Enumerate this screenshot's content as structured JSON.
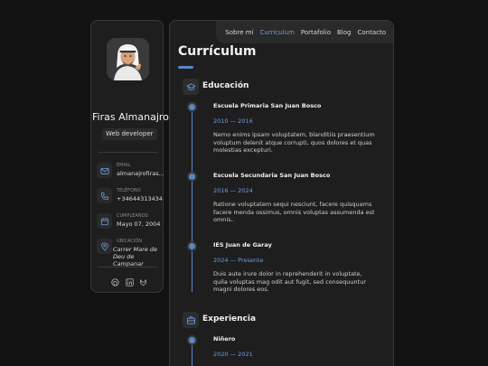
{
  "profile": {
    "name": "Firas Almanajro",
    "role": "Web developer",
    "contacts": [
      {
        "label": "Email",
        "value": "almanajrofiras...",
        "icon": "mail-icon"
      },
      {
        "label": "Teléfono",
        "value": "+34644313434",
        "icon": "phone-icon"
      },
      {
        "label": "Cumpleaños",
        "value": "Mayo 07, 2004",
        "icon": "calendar-icon"
      },
      {
        "label": "Ubicación",
        "value": "Carrer Mare de Deu de Campanar",
        "icon": "location-icon"
      }
    ],
    "socials": [
      "github-icon",
      "linkedin-icon",
      "gitlab-icon"
    ]
  },
  "nav": {
    "items": [
      "Sobre mí",
      "Currículum",
      "Portafolio",
      "Blog",
      "Contacto"
    ],
    "active": "Currículum"
  },
  "page": {
    "title": "Currículum"
  },
  "education": {
    "title": "Educación",
    "items": [
      {
        "title": "Escuela Primaria San Juan Bosco",
        "dates": "2010 — 2016",
        "text": "Nemo enims ipsam voluptatem, blanditiis praesentium voluptum delenit atque corrupti, quos dolores et quas molestias excepturi."
      },
      {
        "title": "Escuela Secundaria San Juan Bosco",
        "dates": "2016 — 2024",
        "text": "Ratione voluptatem sequi nesciunt, facere quisquams facere menda ossimus, omnis voluptas assumenda est omnis.."
      },
      {
        "title": "IES Juan de Garay",
        "dates": "2024 — Presente",
        "text": "Duis aute irure dolor in reprehenderit in voluptate, quila voluptas mag odit aut fugit, sed consequuntur magni dolores eos."
      }
    ]
  },
  "experience": {
    "title": "Experiencia",
    "items": [
      {
        "title": "Niñero",
        "dates": "2020 — 2021"
      }
    ]
  },
  "colors": {
    "accent": "#5a86c5",
    "link": "#6f9fd8",
    "background": "#121212",
    "card": "#1e1e1f"
  }
}
